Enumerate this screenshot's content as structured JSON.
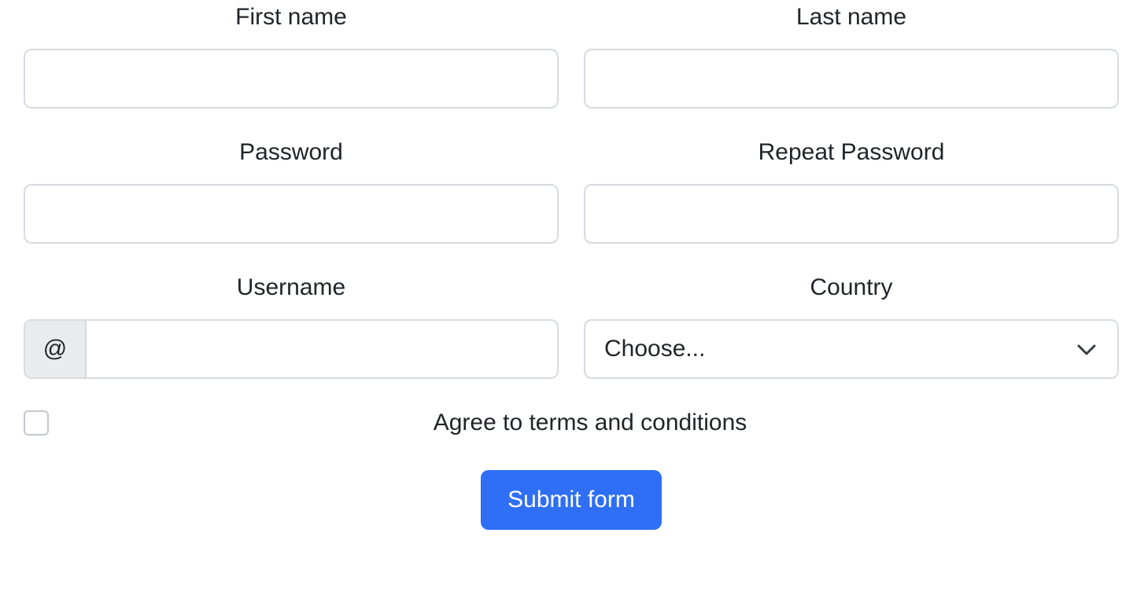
{
  "form": {
    "first_name": {
      "label": "First name",
      "value": ""
    },
    "last_name": {
      "label": "Last name",
      "value": ""
    },
    "password": {
      "label": "Password",
      "value": ""
    },
    "repeat_password": {
      "label": "Repeat Password",
      "value": ""
    },
    "username": {
      "label": "Username",
      "prefix": "@",
      "value": ""
    },
    "country": {
      "label": "Country",
      "selected": "Choose...",
      "icon": "chevron-down-icon"
    },
    "terms": {
      "label": "Agree to terms and conditions",
      "checked": false
    },
    "submit_label": "Submit form"
  },
  "colors": {
    "primary": "#2f6ff5",
    "border": "#d8dbe0",
    "addon_bg": "#e9ecef",
    "text": "#212529"
  }
}
